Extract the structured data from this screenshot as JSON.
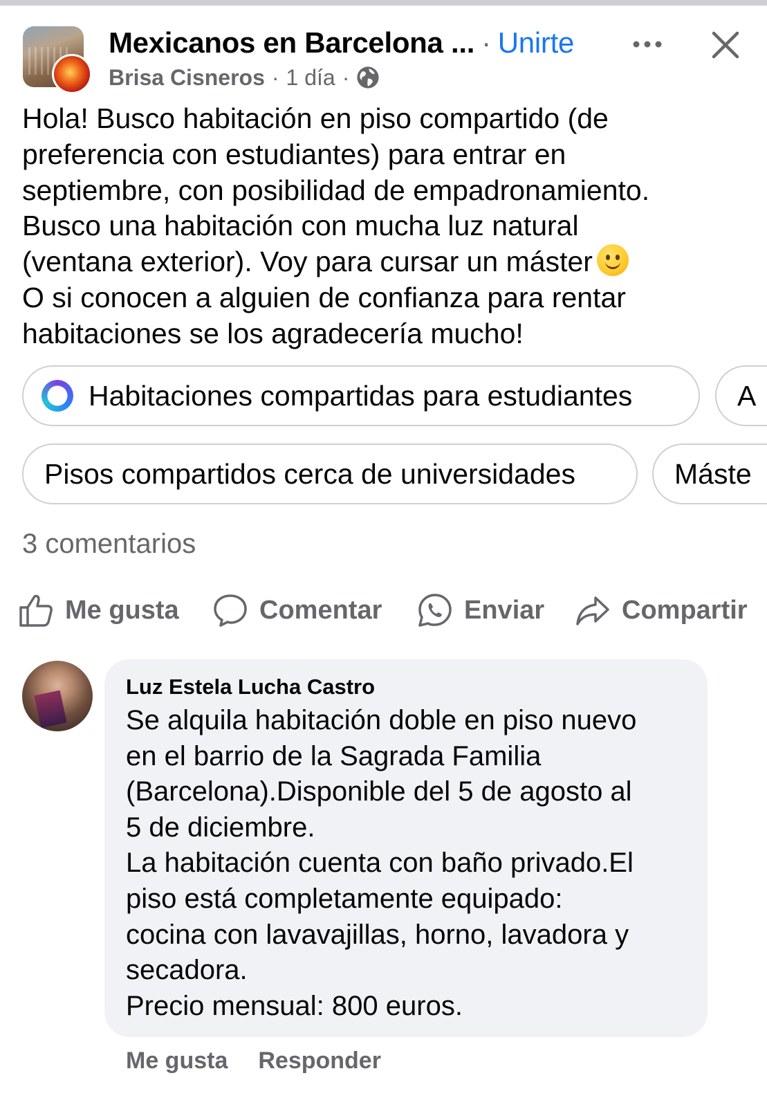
{
  "header": {
    "group_name": "Mexicanos en Barcelona ...",
    "separator": "·",
    "join_label": "Unirte",
    "author": "Brisa Cisneros",
    "time": "1 día",
    "meta_sep": "·",
    "more_icon": "more-horizontal-icon",
    "close_icon": "close-icon",
    "privacy_icon": "globe-icon"
  },
  "post": {
    "text": "Hola! Busco habitación en piso compartido (de\npreferencia con estudiantes) para entrar en\nseptiembre, con posibilidad de empadronamiento.\nBusco una habitación con mucha luz natural\n(ventana exterior). Voy para cursar un máster",
    "text_after_emoji": "\nO si conocen a alguien de confianza para rentar\nhabitaciones se los agradecería mucho!",
    "emoji": "slightly-smiling-face"
  },
  "suggestions": {
    "row1": [
      "Habitaciones compartidas para estudiantes",
      "A"
    ],
    "row2": [
      "Pisos compartidos cerca de universidades",
      "Máste"
    ]
  },
  "comments_count": "3 comentarios",
  "actions": {
    "like": "Me gusta",
    "comment": "Comentar",
    "send": "Enviar",
    "share": "Compartir"
  },
  "comment": {
    "author": "Luz Estela Lucha Castro",
    "text": "Se alquila habitación doble en piso nuevo\nen el barrio de la Sagrada Familia\n(Barcelona).Disponible del 5 de agosto al\n5 de diciembre.\nLa habitación cuenta con baño privado.El\npiso está completamente equipado:\ncocina con lavavajillas, horno, lavadora y\nsecadora.\nPrecio mensual: 800 euros.",
    "like_label": "Me gusta",
    "reply_label": "Responder"
  },
  "colors": {
    "accent": "#1877f2",
    "secondary_text": "#65676b",
    "bubble": "#f0f2f5"
  }
}
